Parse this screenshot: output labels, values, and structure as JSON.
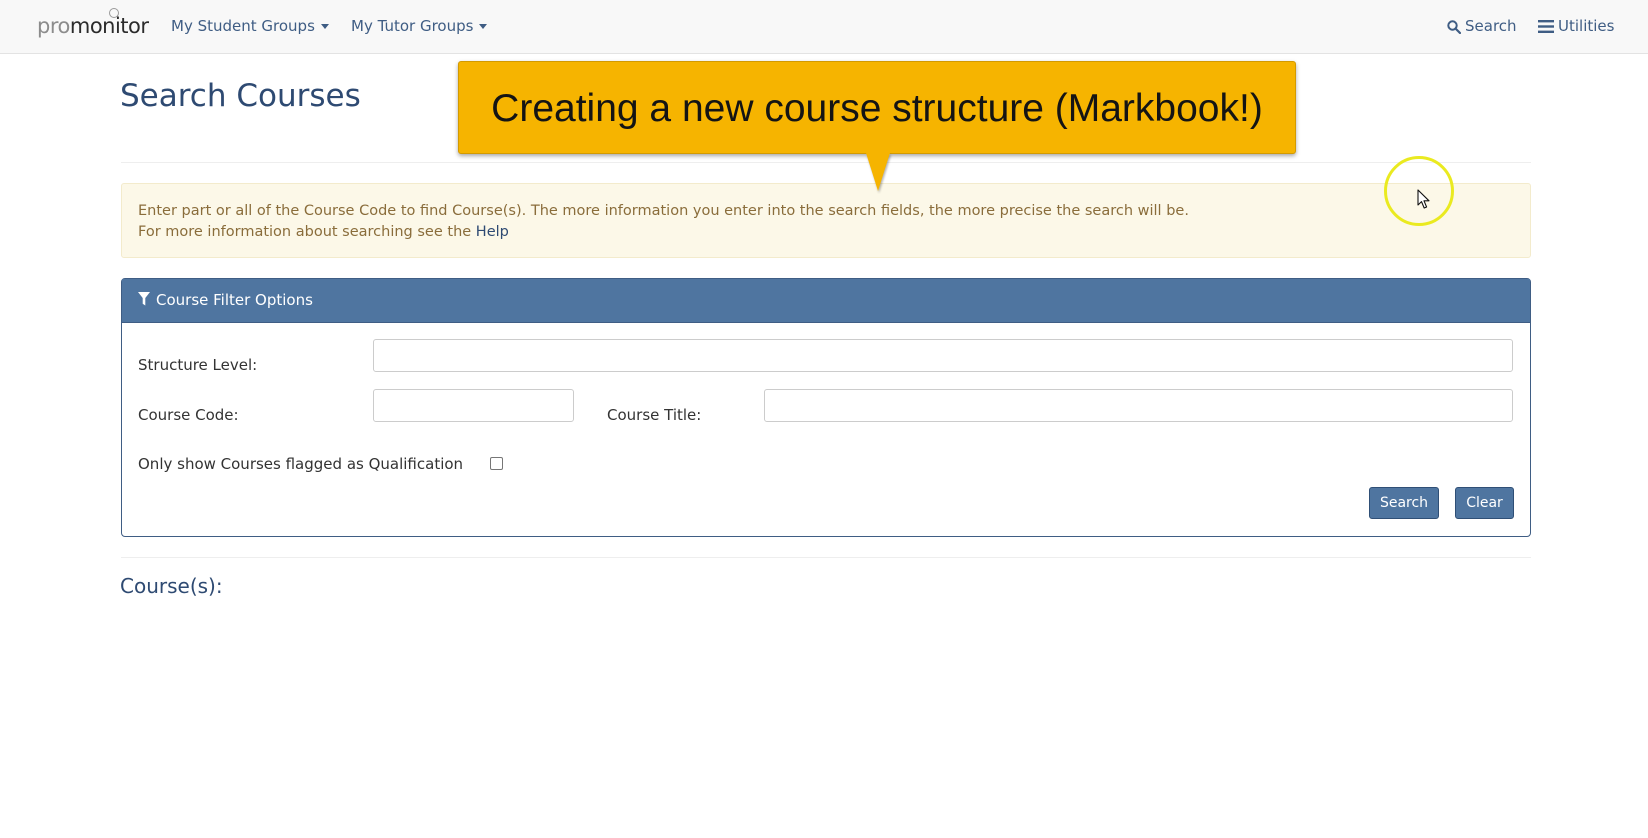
{
  "navbar": {
    "logo_text_light": "pro",
    "logo_text_dark": "monitor",
    "menus": [
      {
        "label": "My Student Groups"
      },
      {
        "label": "My Tutor Groups"
      }
    ],
    "search_label": "Search",
    "utilities_label": "Utilities"
  },
  "page": {
    "title": "Search Courses"
  },
  "callout": {
    "text": "Creating a new course structure (Markbook!)"
  },
  "alert": {
    "line1": "Enter part or all of the Course Code to find Course(s). The more information you enter into the search fields, the more precise the search will be.",
    "line2_prefix": "For more information about searching see the ",
    "help_link": "Help"
  },
  "filter": {
    "heading": "Course Filter Options",
    "structure_level_label": "Structure Level:",
    "structure_level_value": "",
    "course_code_label": "Course Code:",
    "course_code_value": "",
    "course_title_label": "Course Title:",
    "course_title_value": "",
    "qualification_label": "Only show Courses flagged as Qualification",
    "qualification_checked": false,
    "search_button": "Search",
    "clear_button": "Clear"
  },
  "results": {
    "title": "Course(s):"
  },
  "colors": {
    "brand": "#2e4a72",
    "panel_header": "#4f75a0",
    "callout_bg": "#f6b400",
    "alert_bg": "#fcf8e8",
    "alert_text": "#8a6d3b"
  },
  "icons": [
    "search-icon",
    "hamburger-icon",
    "filter-icon",
    "caret-down-icon",
    "mouse-pointer-icon"
  ]
}
